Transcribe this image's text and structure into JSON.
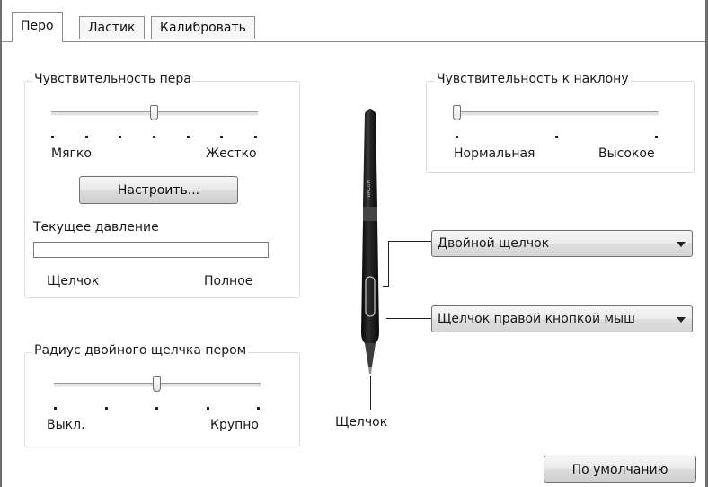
{
  "tabs": [
    {
      "label": "Перо",
      "active": true
    },
    {
      "label": "Ластик",
      "active": false
    },
    {
      "label": "Калибровать",
      "active": false
    }
  ],
  "pen_feel": {
    "title": "Чувствительность пера",
    "min_label": "Мягко",
    "max_label": "Жестко",
    "level_step": 4,
    "step_count": 7,
    "customize_button": "Настроить...",
    "current_pressure_label": "Текущее давление",
    "pressure_min_label": "Щелчок",
    "pressure_max_label": "Полное"
  },
  "tilt": {
    "title": "Чувствительность к наклону",
    "min_label": "Нормальная",
    "max_label": "Высокое",
    "level_step": 1,
    "step_count": 3
  },
  "double_click": {
    "title": "Радиус двойного щелчка пером",
    "min_label": "Выкл.",
    "max_label": "Крупно",
    "level_step": 3,
    "step_count": 5
  },
  "pen_buttons": {
    "upper": "Двойной щелчок",
    "lower": "Щелчок правой кнопкой мыш"
  },
  "tip_label": "Щелчок",
  "pen_brand": "WACOM",
  "default_button": "По умолчанию"
}
